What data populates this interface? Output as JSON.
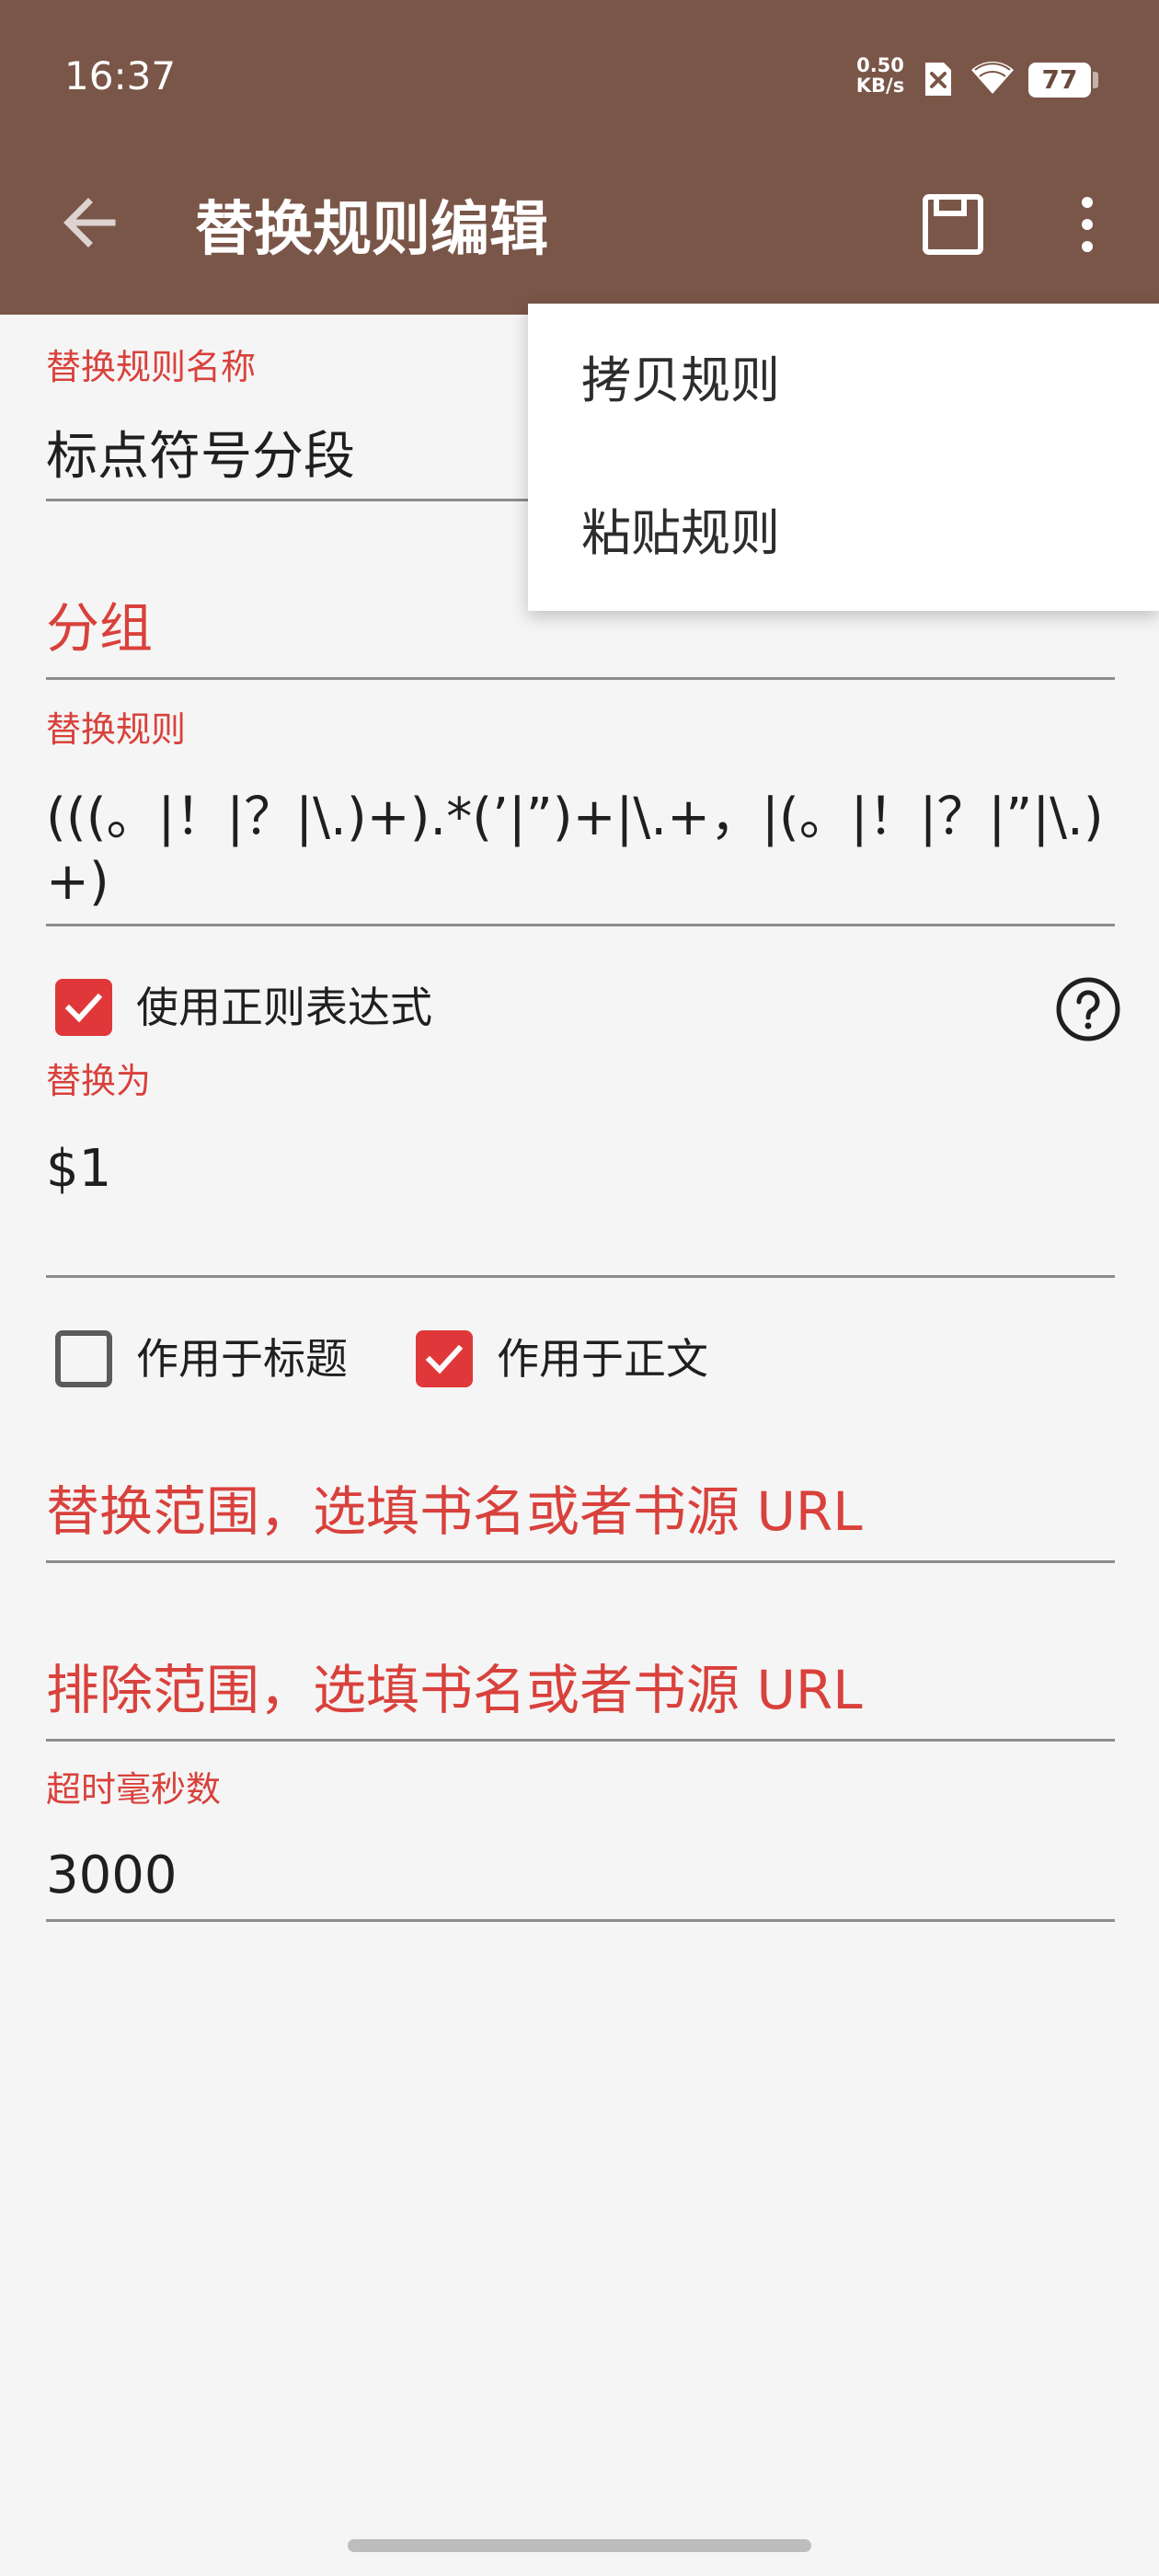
{
  "status_bar": {
    "time": "16:37",
    "net_speed_value": "0.50",
    "net_speed_unit": "KB/s",
    "battery": "77",
    "icons": [
      "sim-off-icon",
      "wifi-icon",
      "battery-icon"
    ]
  },
  "toolbar": {
    "title": "替换规则编辑",
    "back_icon": "arrow-back-icon",
    "save_icon": "save-icon",
    "more_icon": "more-vertical-icon"
  },
  "colors": {
    "app_bar": "#7a5648",
    "accent": "#d9413c",
    "background": "#f5f5f5"
  },
  "form": {
    "name_label": "替换规则名称",
    "name_value": "标点符号分段",
    "group_hint": "分组",
    "pattern_label": "替换规则",
    "pattern_value": "(((。|！|？|\\.)+).*(’|”)+|\\.+，|(。|！|？|”|\\.)+)",
    "use_regex_label": "使用正则表达式",
    "use_regex_checked": true,
    "replacement_label": "替换为",
    "replacement_value": "$1",
    "apply_title_label": "作用于标题",
    "apply_title_checked": false,
    "apply_content_label": "作用于正文",
    "apply_content_checked": true,
    "scope_hint": "替换范围，选填书名或者书源 URL",
    "exclude_hint": "排除范围，选填书名或者书源 URL",
    "timeout_label": "超时毫秒数",
    "timeout_value": "3000"
  },
  "menu": {
    "items": [
      "拷贝规则",
      "粘贴规则"
    ]
  }
}
